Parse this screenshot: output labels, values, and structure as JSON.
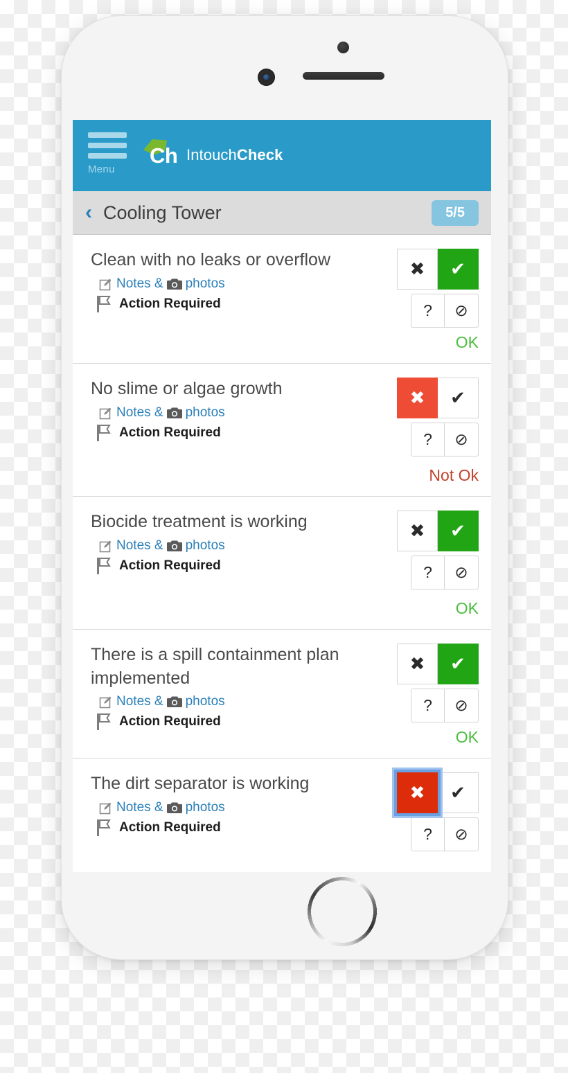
{
  "app": {
    "menu_label": "Menu",
    "brand_prefix": "Intouch",
    "brand_suffix": "Check",
    "logo_text": "Ch",
    "header_color": "#2a9bc9",
    "accent_green": "#22a515",
    "accent_red": "#ee4c35",
    "accent_red_selected": "#dd2c0a"
  },
  "section": {
    "back_label": "‹",
    "title": "Cooling Tower",
    "progress_badge": "5/5"
  },
  "labels": {
    "notes": "Notes &",
    "photos": "photos",
    "action_required": "Action Required",
    "fail_mark": "✖",
    "pass_mark": "✔",
    "unsure_mark": "?",
    "na_mark": "⊘"
  },
  "checklist": [
    {
      "question": "Clean with no leaks or overflow",
      "notes": "Notes &",
      "photos": "photos",
      "flag": "Action Required",
      "state": "ok",
      "status": "OK"
    },
    {
      "question": "No slime or algae growth",
      "notes": "Notes &",
      "photos": "photos",
      "flag": "Action Required",
      "state": "not-ok",
      "status": "Not Ok"
    },
    {
      "question": "Biocide treatment is working",
      "notes": "Notes &",
      "photos": "photos",
      "flag": "Action Required",
      "state": "ok",
      "status": "OK"
    },
    {
      "question": "There is a spill containment plan implemented",
      "notes": "Notes &",
      "photos": "photos",
      "flag": "Action Required",
      "state": "ok",
      "status": "OK"
    },
    {
      "question": "The dirt separator is working",
      "notes": "Notes &",
      "photos": "photos",
      "flag": "Action Required",
      "state": "not-ok-focused",
      "status": ""
    }
  ]
}
